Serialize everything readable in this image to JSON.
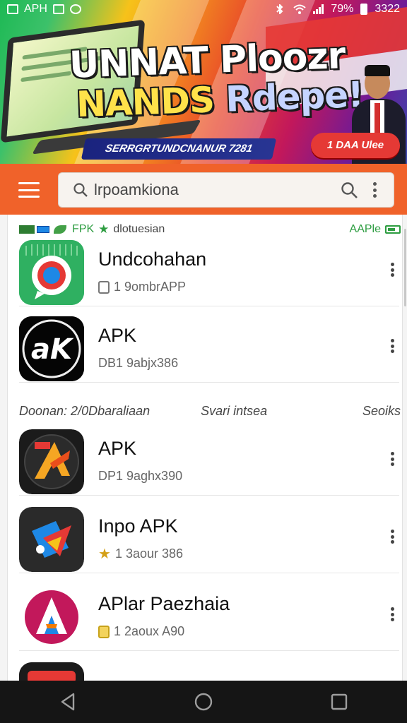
{
  "status_bar": {
    "left_label": "APH",
    "battery_percent": "79%",
    "time": "3322"
  },
  "banner": {
    "headline_line1": "UNNAT Ploozr",
    "headline_line2_yellow": "NANDS ",
    "headline_line2_blue": "Rdepe!",
    "tagline": "SERRGRTUNDCNANUR 7281",
    "promo_badge": "1 DAA Ulee"
  },
  "search": {
    "query": "lrpoamkiona",
    "menu_icon": "hamburger-icon",
    "search_icon": "search-icon",
    "more_icon": "more-vertical-icon"
  },
  "filter_bar": {
    "tag": "FPK",
    "label": "dlotuesian",
    "right_label": "AAPle"
  },
  "apps_section_1": [
    {
      "name": "Undcohahan",
      "meta": "1 9ombrAPP",
      "meta_icon": "lock-icon"
    },
    {
      "name": "APK",
      "meta": "DB1 9abjx386",
      "meta_icon": "none"
    }
  ],
  "section_header": {
    "left": "Doonan: 2/0Dbaraliaan",
    "middle": "Svari intsea",
    "right": "Seoiks"
  },
  "apps_section_2": [
    {
      "name": "APK",
      "meta": "DP1 9aghx390",
      "meta_icon": "none"
    },
    {
      "name": "Inpo APK",
      "meta": "1 3aour 386",
      "meta_icon": "star-icon"
    },
    {
      "name": "APlar Paezhaia",
      "meta": "1 2aoux A90",
      "meta_icon": "lock-icon"
    }
  ],
  "colors": {
    "accent_orange": "#f0622a",
    "star_gold": "#d4a017",
    "green_tag": "#2e9d41"
  }
}
